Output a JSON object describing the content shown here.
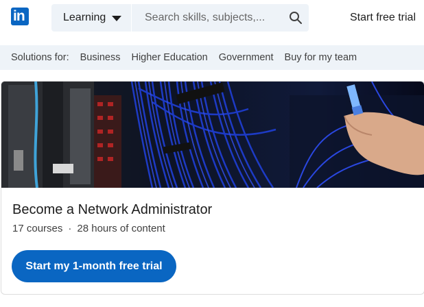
{
  "header": {
    "logo_text": "in",
    "learning_label": "Learning",
    "search_placeholder": "Search skills, subjects,...",
    "start_trial_label": "Start free trial"
  },
  "solutions": {
    "label": "Solutions for:",
    "items": [
      "Business",
      "Higher Education",
      "Government",
      "Buy for my team"
    ]
  },
  "card": {
    "title": "Become a Network Administrator",
    "courses": "17 courses",
    "separator": "·",
    "hours": "28 hours of content",
    "cta_label": "Start my 1-month free trial"
  },
  "colors": {
    "brand": "#0a66c2",
    "bar_background": "#eef3f8",
    "cable_blue": "#1f3fd6"
  }
}
